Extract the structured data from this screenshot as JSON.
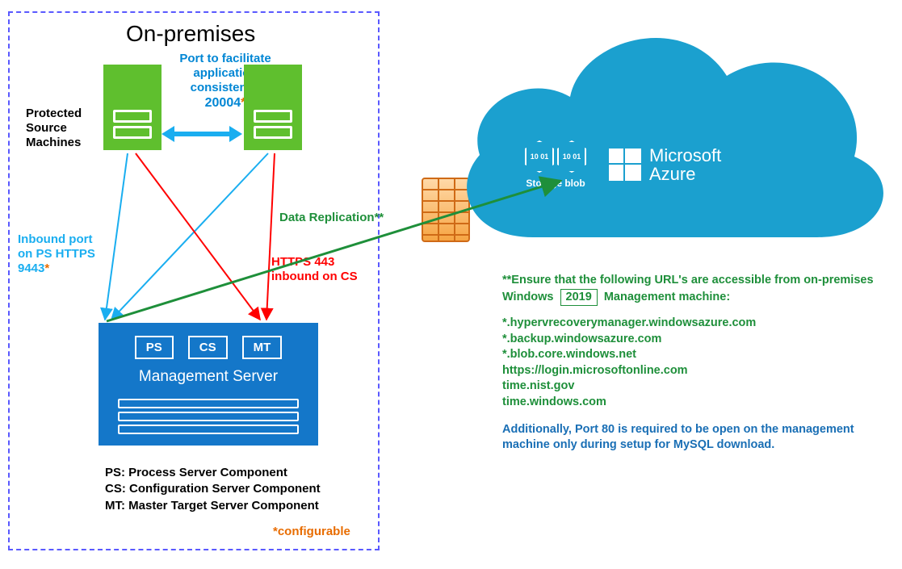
{
  "title": "On-premises",
  "port_app_l1": "Port to facilitate",
  "port_app_l2": "application",
  "port_app_l3": "consistency",
  "port_app_num": "20004",
  "psm_l1": "Protected",
  "psm_l2": "Source",
  "psm_l3": "Machines",
  "inbound_ps_l1": "Inbound port",
  "inbound_ps_l2": "on PS HTTPS",
  "inbound_ps_num": "9443",
  "https443_l1": "HTTPS 443",
  "https443_l2": "inbound on CS",
  "data_repl": "Data Replication**",
  "mgmt": {
    "tabs": {
      "ps": "PS",
      "cs": "CS",
      "mt": "MT"
    },
    "caption": "Management Server"
  },
  "legend": {
    "ps": "PS: Process Server Component",
    "cs": "CS: Configuration Server Component",
    "mt": "MT: Master Target Server Component"
  },
  "configurable": "*configurable",
  "ast": "*",
  "cloud": {
    "storage_label": "Storage blob",
    "hex_code": "10\n01",
    "ms": "Microsoft",
    "azure": "Azure"
  },
  "notes": {
    "ensure_a": "**Ensure that the following URL's are accessible from on-premises Windows",
    "ensure_year": "2019",
    "ensure_b": "Management machine:",
    "urls": [
      "*.hypervrecoverymanager.windowsazure.com",
      "*.backup.windowsazure.com",
      "*.blob.core.windows.net",
      "https://login.microsoftonline.com",
      "time.nist.gov",
      "time.windows.com"
    ],
    "port80": "Additionally, Port 80 is required to be open on the management machine only during setup for MySQL download."
  }
}
